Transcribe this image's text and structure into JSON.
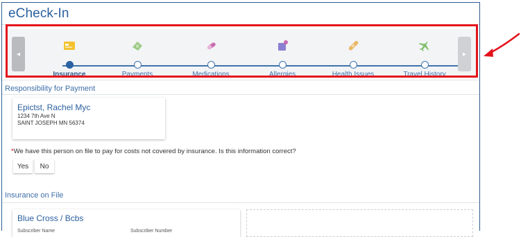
{
  "header": {
    "title": "eCheck-In"
  },
  "stepper": {
    "steps": [
      {
        "label": "Insurance",
        "icon": "insurance-card-icon",
        "active": true
      },
      {
        "label": "Payments",
        "icon": "payments-icon",
        "active": false
      },
      {
        "label": "Medications",
        "icon": "medications-icon",
        "active": false
      },
      {
        "label": "Allergies",
        "icon": "allergies-icon",
        "active": false
      },
      {
        "label": "Health Issues",
        "icon": "health-issues-icon",
        "active": false
      },
      {
        "label": "Travel History",
        "icon": "travel-history-icon",
        "active": false
      }
    ],
    "prev_glyph": "◂",
    "next_glyph": "▸"
  },
  "responsibility": {
    "section_title": "Responsibility for Payment",
    "payer": {
      "name": "Epictst, Rachel Myc",
      "address_line1": "1234 7th Ave N",
      "address_line2": "SAINT JOSEPH MN 56374"
    },
    "required_marker": "*",
    "question": "We have this person on file to pay for costs not covered by insurance. Is this information correct?",
    "yes_label": "Yes",
    "no_label": "No"
  },
  "insurance": {
    "section_title": "Insurance on File",
    "plan_name": "Blue Cross / Bcbs",
    "subscriber_name_label": "Subscriber Name",
    "subscriber_number_label": "Subscriber Number"
  },
  "colors": {
    "accent": "#2a5f9e",
    "highlight_border": "#e3121b",
    "required": "#d0021b",
    "insurance_icon": "#f2c230",
    "payments_icon": "#9ccb86",
    "medications_icon": "#c96bb0",
    "allergies_icon": "#8a7fd1",
    "health_icon": "#e8b96a",
    "travel_icon": "#7fbf6a"
  }
}
